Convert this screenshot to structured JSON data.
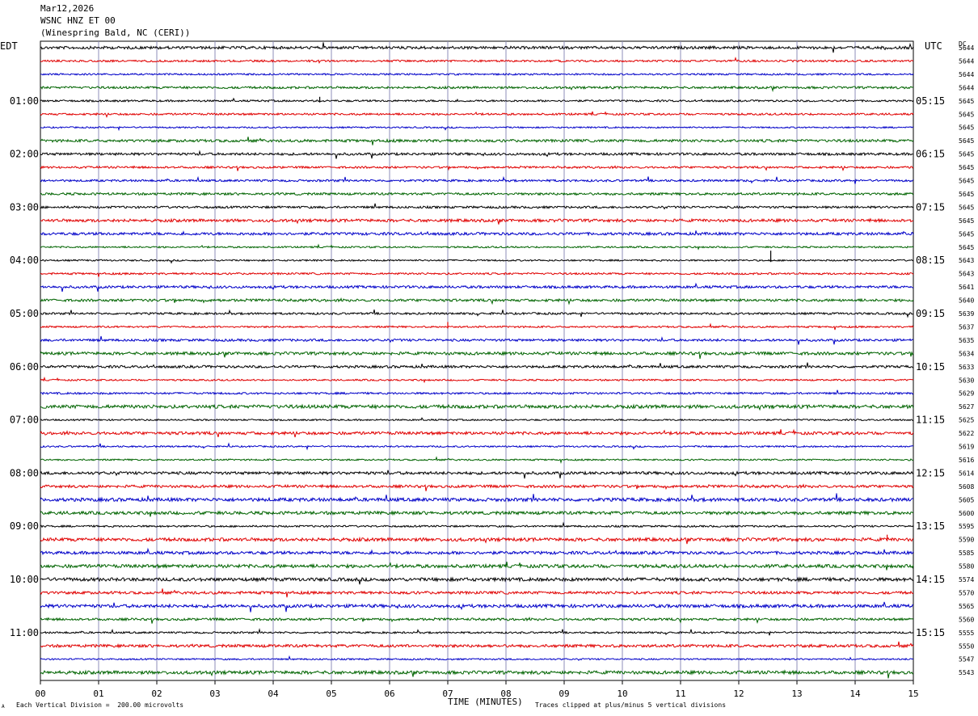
{
  "header": {
    "date": "Mar12,2026",
    "station": "WSNC HNZ ET 00",
    "location": "(Winespring Bald, NC (CERI))"
  },
  "labels": {
    "left_tz": "EDT",
    "right_tz": "UTC",
    "dc": "DC"
  },
  "footer": {
    "scale_note": "Each Vertical Division =  200.00 microvolts",
    "clip_note": "Traces clipped at plus/minus 5 vertical divisions",
    "corner_mark": "A"
  },
  "chart_data": {
    "type": "line",
    "title": "WSNC HNZ ET 00",
    "xlabel": "TIME (MINUTES)",
    "x_ticks": [
      "00",
      "01",
      "02",
      "03",
      "04",
      "05",
      "06",
      "07",
      "08",
      "09",
      "10",
      "11",
      "12",
      "13",
      "14",
      "15"
    ],
    "xlim": [
      0,
      15
    ],
    "grid": true,
    "trace_colors": [
      "#000000",
      "#e00000",
      "#0000c8",
      "#006400"
    ],
    "edt_hour_labels": [
      "01:00",
      "02:00",
      "03:00",
      "04:00",
      "05:00",
      "06:00",
      "07:00",
      "08:00",
      "09:00",
      "10:00",
      "11:00"
    ],
    "utc_hour_labels": [
      "05:15",
      "06:15",
      "07:15",
      "08:15",
      "09:15",
      "10:15",
      "11:15",
      "12:15",
      "13:15",
      "14:15",
      "15:15"
    ],
    "dc_values": [
      "5644",
      "5644",
      "5644",
      "5644",
      "5645",
      "5645",
      "5645",
      "5645",
      "5645",
      "5645",
      "5645",
      "5645",
      "5645",
      "5645",
      "5645",
      "5645",
      "5643",
      "5643",
      "5641",
      "5640",
      "5639",
      "5637",
      "5635",
      "5634",
      "5633",
      "5630",
      "5629",
      "5627",
      "5625",
      "5622",
      "5619",
      "5616",
      "5614",
      "5608",
      "5605",
      "5600",
      "5595",
      "5590",
      "5585",
      "5580",
      "5574",
      "5570",
      "5565",
      "5560",
      "5555",
      "5550",
      "5547",
      "5543"
    ]
  }
}
